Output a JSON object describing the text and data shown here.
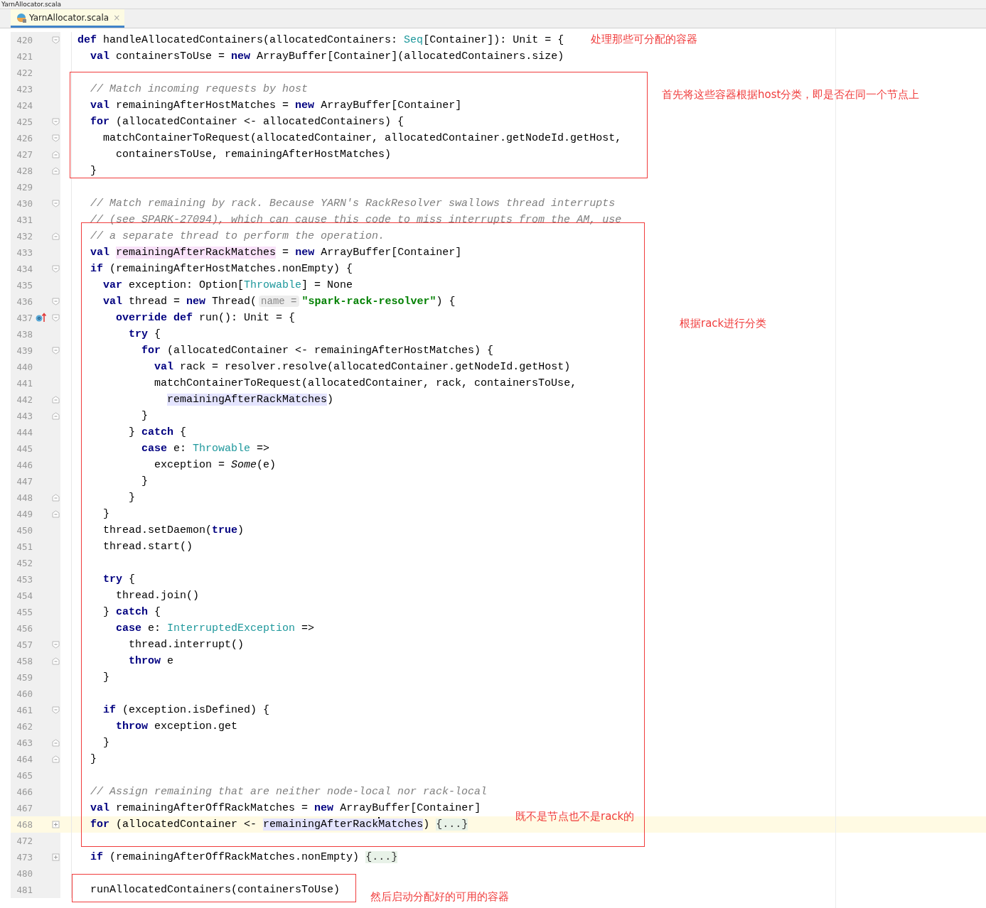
{
  "window": {
    "title": "YarnAllocator.scala"
  },
  "tabs": [
    {
      "label": "YarnAllocator.scala",
      "close": "×",
      "selected": true
    }
  ],
  "code_lines": [
    {
      "number": "420",
      "fold_marker": {
        "kind": "open"
      },
      "current": false,
      "tokens": [
        {
          "kind": "kw",
          "t": "def"
        },
        {
          "kind": "tx",
          "t": " handleAllocatedContainers(allocatedContainers: "
        },
        {
          "kind": "ty",
          "t": "Seq"
        },
        {
          "kind": "tx",
          "t": "[Container]): Unit = {"
        }
      ]
    },
    {
      "number": "421",
      "current": false,
      "tokens": [
        {
          "kind": "kw",
          "t": "  val"
        },
        {
          "kind": "tx",
          "t": " containersToUse = "
        },
        {
          "kind": "kw",
          "t": "new"
        },
        {
          "kind": "tx",
          "t": " ArrayBuffer[Container](allocatedContainers.size)"
        }
      ]
    },
    {
      "number": "422",
      "current": false
    },
    {
      "number": "423",
      "current": false,
      "tokens": [
        {
          "kind": "cm",
          "t": "  // Match incoming requests by host"
        }
      ]
    },
    {
      "number": "424",
      "current": false,
      "tokens": [
        {
          "kind": "kw",
          "t": "  val"
        },
        {
          "kind": "tx",
          "t": " remainingAfterHostMatches = "
        },
        {
          "kind": "kw",
          "t": "new"
        },
        {
          "kind": "tx",
          "t": " ArrayBuffer[Container]"
        }
      ]
    },
    {
      "number": "425",
      "fold_marker": {
        "kind": "open"
      },
      "current": false,
      "tokens": [
        {
          "kind": "kw",
          "t": "  for"
        },
        {
          "kind": "tx",
          "t": " (allocatedContainer <- allocatedContainers) {"
        }
      ]
    },
    {
      "number": "426",
      "fold_marker": {
        "kind": "open"
      },
      "current": false,
      "tokens": [
        {
          "kind": "tx",
          "t": "    matchContainerToRequest(allocatedContainer, allocatedContainer.getNodeId.getHost,"
        }
      ]
    },
    {
      "number": "427",
      "fold_marker": {
        "kind": "close"
      },
      "current": false,
      "tokens": [
        {
          "kind": "tx",
          "t": "      containersToUse, remainingAfterHostMatches)"
        }
      ]
    },
    {
      "number": "428",
      "fold_marker": {
        "kind": "close"
      },
      "current": false,
      "tokens": [
        {
          "kind": "tx",
          "t": "  }"
        }
      ]
    },
    {
      "number": "429",
      "current": false
    },
    {
      "number": "430",
      "fold_marker": {
        "kind": "open"
      },
      "current": false,
      "tokens": [
        {
          "kind": "cm",
          "t": "  // Match remaining by rack. Because YARN's RackResolver swallows thread interrupts"
        }
      ]
    },
    {
      "number": "431",
      "current": false,
      "tokens": [
        {
          "kind": "cm",
          "t": "  // (see SPARK-27094), which can cause this code to miss interrupts from the AM, use"
        }
      ]
    },
    {
      "number": "432",
      "fold_marker": {
        "kind": "close"
      },
      "current": false,
      "tokens": [
        {
          "kind": "cm",
          "t": "  // a separate thread to perform the operation."
        }
      ]
    },
    {
      "number": "433",
      "current": false,
      "tokens": [
        {
          "kind": "kw",
          "t": "  val"
        },
        {
          "kind": "hl",
          "t": " remainingAfterRackMatches"
        },
        {
          "kind": "tx",
          "t": " = "
        },
        {
          "kind": "kw",
          "t": "new"
        },
        {
          "kind": "tx",
          "t": " ArrayBuffer[Container]"
        }
      ]
    },
    {
      "number": "434",
      "fold_marker": {
        "kind": "open"
      },
      "current": false,
      "tokens": [
        {
          "kind": "kw",
          "t": "  if"
        },
        {
          "kind": "tx",
          "t": " (remainingAfterHostMatches.nonEmpty) {"
        }
      ]
    },
    {
      "number": "435",
      "current": false,
      "tokens": [
        {
          "kind": "kw",
          "t": "    var"
        },
        {
          "kind": "tx",
          "t": " exception: Option["
        },
        {
          "kind": "ty",
          "t": "Throwable"
        },
        {
          "kind": "tx",
          "t": "] = None"
        }
      ]
    },
    {
      "number": "436",
      "fold_marker": {
        "kind": "open"
      },
      "current": false,
      "tokens": [
        {
          "kind": "kw",
          "t": "    val"
        },
        {
          "kind": "tx",
          "t": " thread = "
        },
        {
          "kind": "kw",
          "t": "new"
        },
        {
          "kind": "tx",
          "t": " Thread("
        },
        {
          "kind": "hint",
          "t": "name ="
        },
        {
          "kind": "st",
          "t": "\"spark-rack-resolver\""
        },
        {
          "kind": "tx",
          "t": ") {"
        }
      ]
    },
    {
      "number": "437",
      "fold_marker": {
        "kind": "open"
      },
      "gutter_icon": {
        "kind": "override"
      },
      "current": false,
      "tokens": [
        {
          "kind": "kw",
          "t": "      override def"
        },
        {
          "kind": "tx",
          "t": " run(): Unit = {"
        }
      ]
    },
    {
      "number": "438",
      "current": false,
      "tokens": [
        {
          "kind": "kw",
          "t": "        try"
        },
        {
          "kind": "tx",
          "t": " {"
        }
      ]
    },
    {
      "number": "439",
      "fold_marker": {
        "kind": "open"
      },
      "current": false,
      "tokens": [
        {
          "kind": "kw",
          "t": "          for"
        },
        {
          "kind": "tx",
          "t": " (allocatedContainer <- remainingAfterHostMatches) {"
        }
      ]
    },
    {
      "number": "440",
      "current": false,
      "tokens": [
        {
          "kind": "kw",
          "t": "            val"
        },
        {
          "kind": "tx",
          "t": " rack = resolver.resolve(allocatedContainer.getNodeId.getHost)"
        }
      ]
    },
    {
      "number": "441",
      "current": false,
      "tokens": [
        {
          "kind": "tx",
          "t": "            matchContainerToRequest(allocatedContainer, rack, containersToUse,"
        }
      ]
    },
    {
      "number": "442",
      "fold_marker": {
        "kind": "close"
      },
      "current": false,
      "tokens": [
        {
          "kind": "ref",
          "t": "              remainingAfterRackMatches"
        },
        {
          "kind": "tx",
          "t": ")"
        }
      ]
    },
    {
      "number": "443",
      "fold_marker": {
        "kind": "close"
      },
      "current": false,
      "tokens": [
        {
          "kind": "tx",
          "t": "          }"
        }
      ]
    },
    {
      "number": "444",
      "current": false,
      "tokens": [
        {
          "kind": "tx",
          "t": "        }"
        },
        {
          "kind": "kw",
          "t": " catch"
        },
        {
          "kind": "tx",
          "t": " {"
        }
      ]
    },
    {
      "number": "445",
      "current": false,
      "tokens": [
        {
          "kind": "kw",
          "t": "          case"
        },
        {
          "kind": "tx",
          "t": " e: "
        },
        {
          "kind": "ty",
          "t": "Throwable"
        },
        {
          "kind": "tx",
          "t": " =>"
        }
      ]
    },
    {
      "number": "446",
      "current": false,
      "tokens": [
        {
          "kind": "tx",
          "t": "            exception = "
        },
        {
          "kind": "it",
          "t": "Some"
        },
        {
          "kind": "tx",
          "t": "(e)"
        }
      ]
    },
    {
      "number": "447",
      "current": false,
      "tokens": [
        {
          "kind": "tx",
          "t": "          }"
        }
      ]
    },
    {
      "number": "448",
      "fold_marker": {
        "kind": "close"
      },
      "current": false,
      "tokens": [
        {
          "kind": "tx",
          "t": "        }"
        }
      ]
    },
    {
      "number": "449",
      "fold_marker": {
        "kind": "close"
      },
      "current": false,
      "tokens": [
        {
          "kind": "tx",
          "t": "    }"
        }
      ]
    },
    {
      "number": "450",
      "current": false,
      "tokens": [
        {
          "kind": "tx",
          "t": "    thread.setDaemon("
        },
        {
          "kind": "kw",
          "t": "true"
        },
        {
          "kind": "tx",
          "t": ")"
        }
      ]
    },
    {
      "number": "451",
      "current": false,
      "tokens": [
        {
          "kind": "tx",
          "t": "    thread.start()"
        }
      ]
    },
    {
      "number": "452",
      "current": false
    },
    {
      "number": "453",
      "current": false,
      "tokens": [
        {
          "kind": "kw",
          "t": "    try"
        },
        {
          "kind": "tx",
          "t": " {"
        }
      ]
    },
    {
      "number": "454",
      "current": false,
      "tokens": [
        {
          "kind": "tx",
          "t": "      thread.join()"
        }
      ]
    },
    {
      "number": "455",
      "current": false,
      "tokens": [
        {
          "kind": "tx",
          "t": "    }"
        },
        {
          "kind": "kw",
          "t": " catch"
        },
        {
          "kind": "tx",
          "t": " {"
        }
      ]
    },
    {
      "number": "456",
      "current": false,
      "tokens": [
        {
          "kind": "kw",
          "t": "      case"
        },
        {
          "kind": "tx",
          "t": " e: "
        },
        {
          "kind": "ty",
          "t": "InterruptedException"
        },
        {
          "kind": "tx",
          "t": " =>"
        }
      ]
    },
    {
      "number": "457",
      "fold_marker": {
        "kind": "open"
      },
      "current": false,
      "tokens": [
        {
          "kind": "tx",
          "t": "        thread.interrupt()"
        }
      ]
    },
    {
      "number": "458",
      "fold_marker": {
        "kind": "close"
      },
      "current": false,
      "tokens": [
        {
          "kind": "kw",
          "t": "        throw"
        },
        {
          "kind": "tx",
          "t": " e"
        }
      ]
    },
    {
      "number": "459",
      "current": false,
      "tokens": [
        {
          "kind": "tx",
          "t": "    }"
        }
      ]
    },
    {
      "number": "460",
      "current": false
    },
    {
      "number": "461",
      "fold_marker": {
        "kind": "open"
      },
      "current": false,
      "tokens": [
        {
          "kind": "kw",
          "t": "    if"
        },
        {
          "kind": "tx",
          "t": " (exception.isDefined) {"
        }
      ]
    },
    {
      "number": "462",
      "current": false,
      "tokens": [
        {
          "kind": "kw",
          "t": "      throw"
        },
        {
          "kind": "tx",
          "t": " exception.get"
        }
      ]
    },
    {
      "number": "463",
      "fold_marker": {
        "kind": "close"
      },
      "current": false,
      "tokens": [
        {
          "kind": "tx",
          "t": "    }"
        }
      ]
    },
    {
      "number": "464",
      "fold_marker": {
        "kind": "close"
      },
      "current": false,
      "tokens": [
        {
          "kind": "tx",
          "t": "  }"
        }
      ]
    },
    {
      "number": "465",
      "current": false
    },
    {
      "number": "466",
      "current": false,
      "tokens": [
        {
          "kind": "cm",
          "t": "  // Assign remaining that are neither node-local nor rack-local"
        }
      ]
    },
    {
      "number": "467",
      "current": false,
      "tokens": [
        {
          "kind": "kw",
          "t": "  val"
        },
        {
          "kind": "tx",
          "t": " remainingAfterOffRackMatches = "
        },
        {
          "kind": "kw",
          "t": "new"
        },
        {
          "kind": "tx",
          "t": " ArrayBuffer[Container]"
        }
      ]
    },
    {
      "number": "468",
      "fold_marker": {
        "kind": "collapsed"
      },
      "current": true,
      "tokens": [
        {
          "kind": "kw",
          "t": "  for"
        },
        {
          "kind": "tx",
          "t": " (allocatedContainer <-"
        },
        {
          "kind": "ref",
          "t": " remainingAfterRack"
        },
        {
          "kind": "caret"
        },
        {
          "kind": "ref",
          "t": "Matches"
        },
        {
          "kind": "tx",
          "t": ")"
        },
        {
          "kind": "fold",
          "t": " {...}"
        }
      ]
    },
    {
      "number": "472",
      "current": false
    },
    {
      "number": "473",
      "fold_marker": {
        "kind": "collapsed"
      },
      "current": false,
      "tokens": [
        {
          "kind": "kw",
          "t": "  if"
        },
        {
          "kind": "tx",
          "t": " (remainingAfterOffRackMatches.nonEmpty)"
        },
        {
          "kind": "fold",
          "t": " {...}"
        }
      ]
    },
    {
      "number": "480",
      "current": false
    },
    {
      "number": "481",
      "current": false,
      "tokens": [
        {
          "kind": "tx",
          "t": "  runAllocatedContainers(containersToUse)"
        }
      ]
    }
  ],
  "annotations": [
    {
      "text": "处理那些可分配的容器"
    },
    {
      "text": "首先将这些容器根据host分类，即是否在同一个节点上"
    },
    {
      "text": "根据rack进行分类"
    },
    {
      "text": "既不是节点也不是rack的"
    },
    {
      "text": "然后启动分配好的可用的容器"
    }
  ]
}
